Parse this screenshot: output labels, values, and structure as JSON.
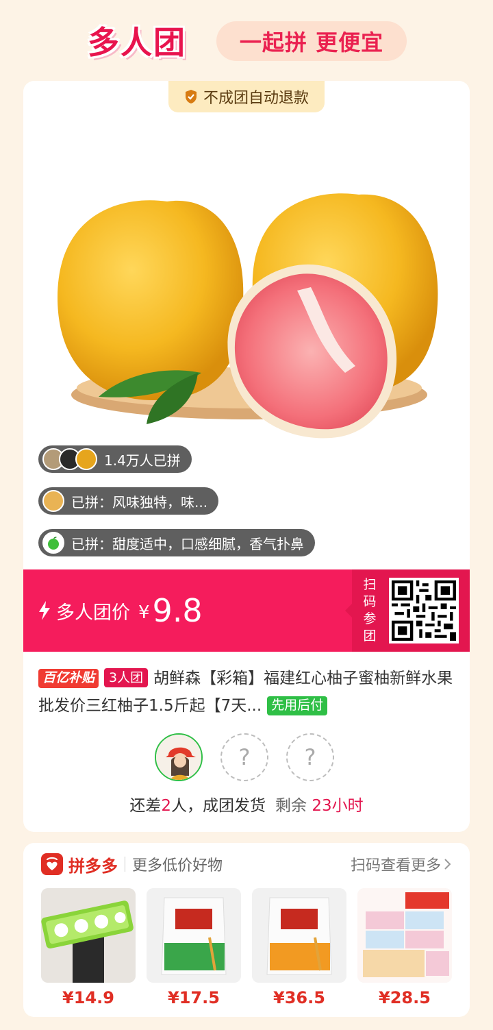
{
  "header": {
    "logo": "多人团",
    "slogan": "一起拼 更便宜"
  },
  "card": {
    "refund_badge": "不成团自动退款",
    "joined_count": "1.4万人已拼",
    "review1": "已拼：风味独特，味...",
    "review2": "已拼：甜度适中，口感细腻，香气扑鼻",
    "price_label": "多人团价",
    "currency": "¥",
    "price": "9.8",
    "scan_label": "扫码参团",
    "tag_subsidy": "百亿补贴",
    "tag_group": "3人团",
    "title": "胡鲜森【彩箱】福建红心柚子蜜柚新鲜水果批发价三红柚子1.5斤起【7天...",
    "tag_pay": "先用后付",
    "status_prefix": "还差",
    "status_count": "2",
    "status_suffix": "人，成团发货",
    "remain_label": "剩余",
    "remain_time": "23小时",
    "slot_placeholder": "?"
  },
  "more": {
    "brand": "拼多多",
    "subtitle": "更多低价好物",
    "see_more": "扫码查看更多",
    "goods": [
      {
        "price": "¥14.9",
        "icon": "toilet-paper-pack"
      },
      {
        "price": "¥17.5",
        "icon": "flour-bag-green"
      },
      {
        "price": "¥36.5",
        "icon": "flour-bag-orange"
      },
      {
        "price": "¥28.5",
        "icon": "tissue-boxes"
      }
    ]
  },
  "colors": {
    "accent": "#f51c5c",
    "brand_red": "#e02e24",
    "green": "#2fbf46",
    "bg": "#fdf3e6"
  }
}
